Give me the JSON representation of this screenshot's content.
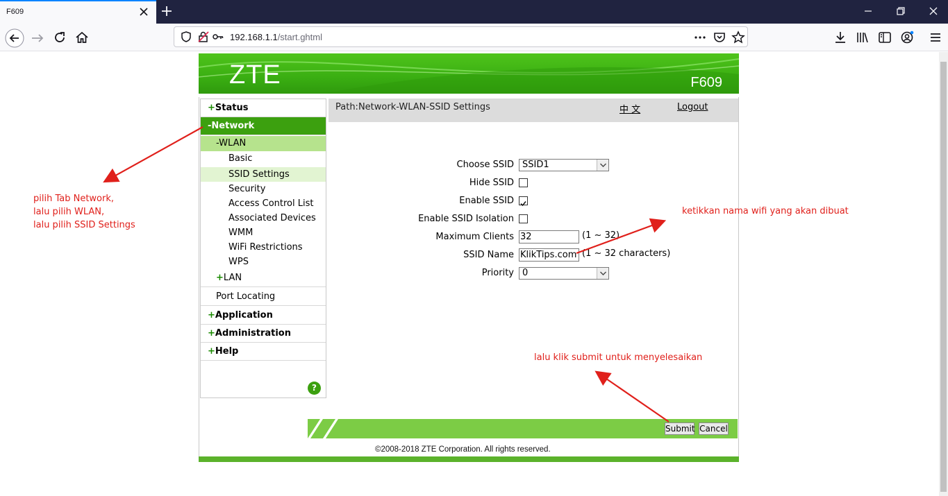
{
  "browser": {
    "tab_title": "F609",
    "url_host": "192.168.1.1",
    "url_path": "/start.ghtml"
  },
  "banner": {
    "logo": "ZTE",
    "model": "F609"
  },
  "sidebar": {
    "status": "Status",
    "network": "Network",
    "wlan": "WLAN",
    "wlan_items": [
      "Basic",
      "SSID Settings",
      "Security",
      "Access Control List",
      "Associated Devices",
      "WMM",
      "WiFi Restrictions",
      "WPS"
    ],
    "lan": "LAN",
    "port_locating": "Port Locating",
    "application": "Application",
    "administration": "Administration",
    "help": "Help",
    "plus": "+",
    "minus": "-",
    "help_icon": "?"
  },
  "pathbar": {
    "path": "Path:Network-WLAN-SSID Settings",
    "lang": "中 文",
    "logout": "Logout"
  },
  "form": {
    "choose_ssid_label": "Choose SSID",
    "choose_ssid_value": "SSID1",
    "hide_ssid_label": "Hide SSID",
    "hide_ssid_checked": false,
    "enable_ssid_label": "Enable SSID",
    "enable_ssid_checked": true,
    "isolation_label": "Enable SSID Isolation",
    "isolation_checked": false,
    "max_clients_label": "Maximum Clients",
    "max_clients_value": "32",
    "max_clients_hint": "(1 ~ 32)",
    "ssid_name_label": "SSID Name",
    "ssid_name_value": "KlikTips.com",
    "ssid_name_hint": "(1 ~ 32 characters)",
    "priority_label": "Priority",
    "priority_value": "0"
  },
  "buttons": {
    "submit": "Submit",
    "cancel": "Cancel"
  },
  "footer": {
    "copyright": "©2008-2018 ZTE Corporation. All rights reserved."
  },
  "annotations": {
    "note1": "pilih Tab Network,\nlalu pilih WLAN,\nlalu pilih SSID Settings",
    "note2": "ketikkan nama wifi yang akan dibuat",
    "note3": "lalu klik submit untuk menyelesaikan",
    "color": "#e0201b"
  },
  "colors": {
    "brand_green": "#3ca00f",
    "banner_green": "#4fc41b",
    "bar_green": "#7ccc45"
  }
}
